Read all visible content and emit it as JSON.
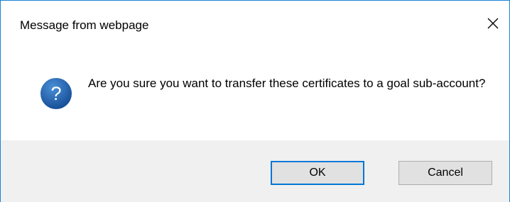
{
  "dialog": {
    "title": "Message from webpage",
    "message": "Are you sure you want to transfer these certificates to a goal sub-account?",
    "icon": "question-icon",
    "ok_label": "OK",
    "cancel_label": "Cancel",
    "close_icon": "close-icon"
  },
  "colors": {
    "accent": "#0078d7",
    "icon_blue": "#1c5eab",
    "footer_bg": "#f0f0f0",
    "button_bg": "#e1e1e1"
  }
}
